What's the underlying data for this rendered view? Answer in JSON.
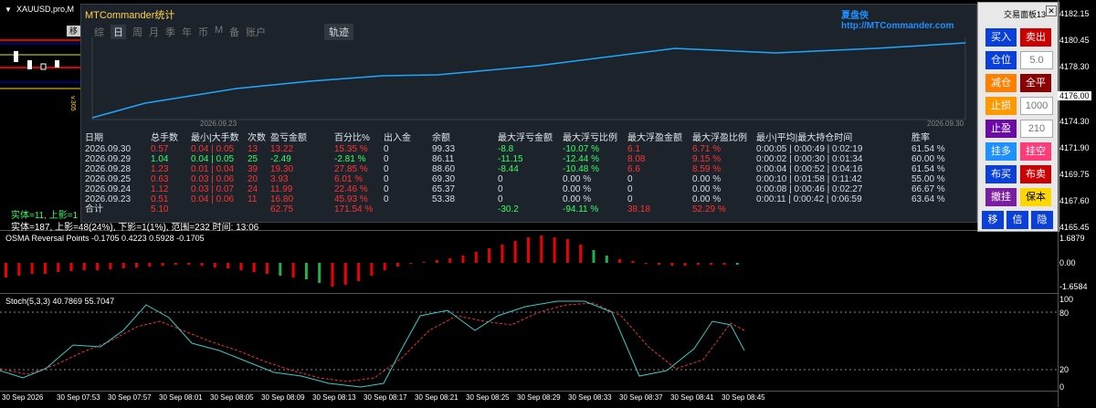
{
  "symbol": "XAUUSD,pro,M",
  "move_btn": "移",
  "chart_overlay": {
    "line1": "实体=11, 上影=1",
    "line2": "实体=187, 上影=48(24%), 下影=1(1%), 范围=232 时间: 13:06"
  },
  "panel": {
    "title": "MTCommander统计",
    "brand": "夏盘侠 http://MTCommander.com",
    "tabs": [
      "综",
      "日",
      "周",
      "月",
      "季",
      "年",
      "币",
      "M",
      "备",
      "账户"
    ],
    "selected_tab": "日",
    "track_btn": "轨迹",
    "date_start": "2026.09.23",
    "date_end": "2026.09.30",
    "headers": [
      "日期",
      "总手数",
      "最小|大手数",
      "次数",
      "盈亏金额",
      "百分比%",
      "出入金",
      "余额",
      "最大浮亏金额",
      "最大浮亏比例",
      "最大浮盈金额",
      "最大浮盈比例",
      "最小|平均|最大持仓时间",
      "胜率"
    ],
    "rows": [
      [
        "2026.09.30",
        "0.57",
        "0.04 | 0.05",
        "13",
        "13.22",
        "15.35 %",
        "0",
        "99.33",
        "-8.8",
        "-10.07 %",
        "6.1",
        "6.71 %",
        "0:00:05 | 0:00:49 | 0:02:19",
        "61.54 %"
      ],
      [
        "2026.09.29",
        "1.04",
        "0.04 | 0.05",
        "25",
        "-2.49",
        "-2.81 %",
        "0",
        "86.11",
        "-11.15",
        "-12.44 %",
        "8.08",
        "9.15 %",
        "0:00:02 | 0:00:30 | 0:01:34",
        "60.00 %"
      ],
      [
        "2026.09.28",
        "1.23",
        "0.01 | 0.04",
        "39",
        "19.30",
        "27.85 %",
        "0",
        "88.60",
        "-8.44",
        "-10.48 %",
        "6.6",
        "8.59 %",
        "0:00:04 | 0:00:52 | 0:04:16",
        "61.54 %"
      ],
      [
        "2026.09.25",
        "0.63",
        "0.03 | 0.06",
        "20",
        "3.93",
        "6.01 %",
        "0",
        "69.30",
        "0",
        "0.00 %",
        "0",
        "0.00 %",
        "0:00:10 | 0:01:58 | 0:11:42",
        "55.00 %"
      ],
      [
        "2026.09.24",
        "1.12",
        "0.03 | 0.07",
        "24",
        "11.99",
        "22.46 %",
        "0",
        "65.37",
        "0",
        "0.00 %",
        "0",
        "0.00 %",
        "0:00:08 | 0:00:46 | 0:02:27",
        "66.67 %"
      ],
      [
        "2026.09.23",
        "0.51",
        "0.04 | 0.06",
        "11",
        "16.80",
        "45.93 %",
        "0",
        "53.38",
        "0",
        "0.00 %",
        "0",
        "0.00 %",
        "0:00:11 | 0:00:42 | 0:06:59",
        "63.64 %"
      ]
    ],
    "total": [
      "合计",
      "5.10",
      "",
      "",
      "62.75",
      "171.54 %",
      "",
      "",
      "-30.2",
      "-94.11 %",
      "38.18",
      "52.29 %",
      "",
      ""
    ]
  },
  "trade_panel": {
    "title": "交易面板13",
    "buttons": [
      [
        "买入",
        "卖出"
      ],
      [
        "仓位",
        "5.0"
      ],
      [
        "减仓",
        "全平"
      ],
      [
        "止损",
        "1000"
      ],
      [
        "止盈",
        "210"
      ],
      [
        "挂多",
        "挂空"
      ],
      [
        "布买",
        "布卖"
      ],
      [
        "撤挂",
        "保本"
      ],
      [
        "移",
        "信",
        "隐"
      ]
    ]
  },
  "price_axis": [
    "4182.15",
    "4180.45",
    "4178.30",
    "4176.00",
    "4174.30",
    "4171.90",
    "4169.75",
    "4167.60",
    "4165.45"
  ],
  "osma": {
    "label": "OSMA Reversal Points -0.1705 0.4223 0.5928 -0.1705",
    "axis": [
      "1.6879",
      "0.00",
      "-1.6584"
    ]
  },
  "stoch": {
    "label": "Stoch(5,3,3) 40.7869 55.7047",
    "axis": [
      "100",
      "80",
      "20",
      "0"
    ]
  },
  "time_axis": [
    "30 Sep 2026",
    "30 Sep 07:53",
    "30 Sep 07:57",
    "30 Sep 08:01",
    "30 Sep 08:05",
    "30 Sep 08:09",
    "30 Sep 08:13",
    "30 Sep 08:17",
    "30 Sep 08:21",
    "30 Sep 08:25",
    "30 Sep 08:29",
    "30 Sep 08:33",
    "30 Sep 08:37",
    "30 Sep 08:41",
    "30 Sep 08:45"
  ],
  "colors": {
    "accent_blue": "#1e90ff",
    "buy_blue": "#0a3fd9",
    "sell_red": "#cc0000",
    "profit_green": "#33ff66",
    "loss_red": "#ff3333"
  }
}
